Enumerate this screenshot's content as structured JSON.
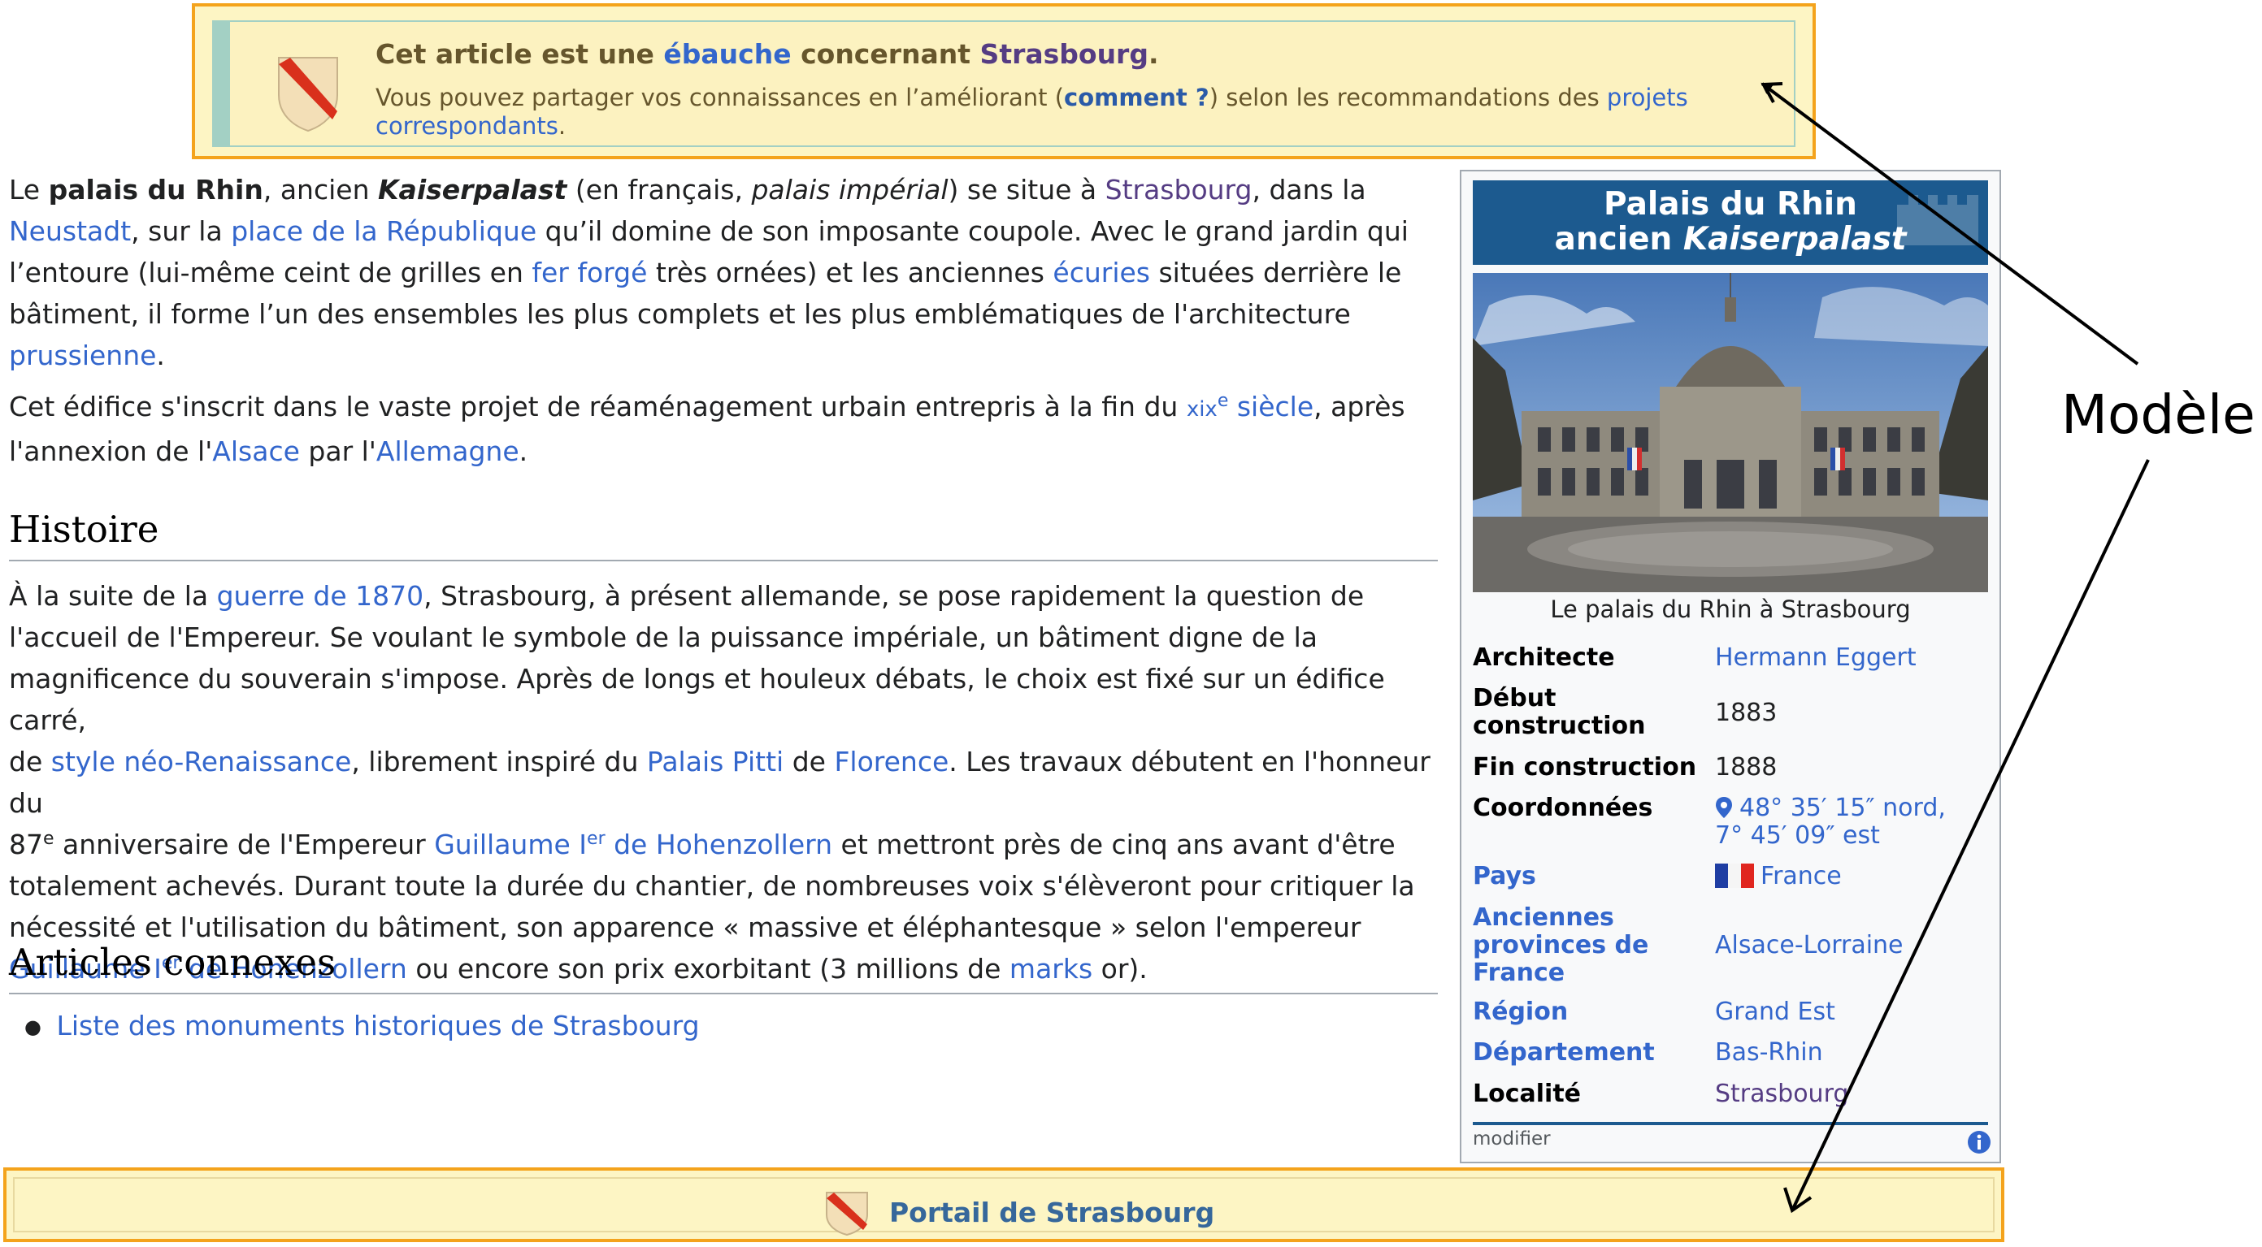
{
  "stub": {
    "title_pre": "Cet article est une ",
    "title_link1": "ébauche",
    "title_mid": " concernant ",
    "title_link2": "Strasbourg",
    "title_end": ".",
    "text_pre": "Vous pouvez partager vos connaissances en l’améliorant (",
    "text_bold_link": "comment ?",
    "text_mid": ") selon les recommandations des ",
    "text_link": "projets correspondants",
    "text_end": "."
  },
  "intro": {
    "p1": {
      "t1": "Le ",
      "b1": "palais du Rhin",
      "t2": ", ancien ",
      "bi1": "Kaiserpalast",
      "t3": " (en français, ",
      "i1": "palais impérial",
      "t4": ") se situe à ",
      "l1": "Strasbourg",
      "t5": ", dans la",
      "l2": "Neustadt",
      "t6": ", sur la ",
      "l3": "place de la République",
      "t7": " qu’il domine de son imposante coupole. Avec le grand jardin qui",
      "t8": "l’entoure (lui-même ceint de grilles en ",
      "l4": "fer forgé",
      "t9": " très ornées) et les anciennes ",
      "l5": "écuries",
      "t10": " situées derrière le",
      "t11": "bâtiment, il forme l’un des ensembles les plus complets et les plus emblématiques de l'architecture",
      "l6": "prussienne",
      "t12": "."
    },
    "p2": {
      "t1": "Cet édifice s'inscrit dans le vaste projet de réaménagement urbain entrepris à la fin du ",
      "l1_sc": "xix",
      "l1_sup": "e",
      "l1_rest": " siècle",
      "t2": ", après",
      "t3": "l'annexion de l'",
      "l2": "Alsace",
      "t4": " par l'",
      "l3": "Allemagne",
      "t5": "."
    }
  },
  "histoire": {
    "heading": "Histoire",
    "lines": {
      "a1": "À la suite de la ",
      "a2": "guerre de 1870",
      "a3": ", Strasbourg, à présent allemande, se pose rapidement la question de",
      "b1": "l'accueil de l'Empereur. Se voulant le symbole de la puissance impériale, un bâtiment digne de la",
      "c1": "magnificence du souverain s'impose. Après de longs et houleux débats, le choix est fixé sur un édifice carré,",
      "d1": "de ",
      "d2": "style néo-Renaissance",
      "d3": ", librement inspiré du ",
      "d4": "Palais Pitti",
      "d5": " de ",
      "d6": "Florence",
      "d7": ". Les travaux débutent en l'honneur du",
      "e1": "87",
      "e1sup": "e",
      "e2": " anniversaire de l'Empereur ",
      "e3": "Guillaume I",
      "e3sup": "er",
      "e3b": " de Hohenzollern",
      "e4": " et mettront près de cinq ans avant d'être",
      "f1": "totalement achevés. Durant toute la durée du chantier, de nombreuses voix s'élèveront pour critiquer la",
      "g1": "nécessité et l'utilisation du bâtiment, son apparence « massive et éléphantesque » selon l'empereur",
      "h1": "Guillaume I",
      "h1sup": "er",
      "h1b": " de Hohenzollern",
      "h2": " ou encore son prix exorbitant (3 millions de ",
      "h3": "marks",
      "h4": " or)."
    }
  },
  "connexes": {
    "heading": "Articles connexes",
    "items": [
      "Liste des monuments historiques de Strasbourg"
    ]
  },
  "infobox": {
    "title_line1": "Palais du Rhin",
    "title_line2_pre": "ancien ",
    "title_line2_italic": "Kaiserpalast",
    "caption": "Le palais du Rhin à Strasbourg",
    "rows": [
      {
        "label": "Architecte",
        "value": "Hermann Eggert"
      },
      {
        "label_line1": "Début",
        "label_line2": "construction",
        "value": "1883"
      },
      {
        "label": "Fin construction",
        "value": "1888"
      },
      {
        "label": "Coordonnées",
        "value_line1": "48° 35′ 15″ nord,",
        "value_line2": "7° 45′ 09″ est"
      },
      {
        "label": "Pays",
        "value": "France"
      },
      {
        "label_line1": "Anciennes",
        "label_line2": "provinces de",
        "label_line3": "France",
        "value": "Alsace-Lorraine"
      },
      {
        "label": "Région",
        "value": "Grand Est"
      },
      {
        "label": "Département",
        "value": "Bas-Rhin"
      },
      {
        "label": "Localité",
        "value": "Strasbourg"
      }
    ],
    "edit_link": "modifier",
    "info_icon": "info-icon"
  },
  "portal": {
    "label": "Portail de Strasbourg",
    "icon": "strasbourg-shield-icon"
  },
  "annotation": {
    "label": "Modèle"
  },
  "colors": {
    "link": "#3366cc",
    "visited": "#553c83",
    "infobox_title_bg": "#1c5a8f",
    "notice_border": "#f4a31c",
    "notice_bg": "#fdf5c4"
  }
}
